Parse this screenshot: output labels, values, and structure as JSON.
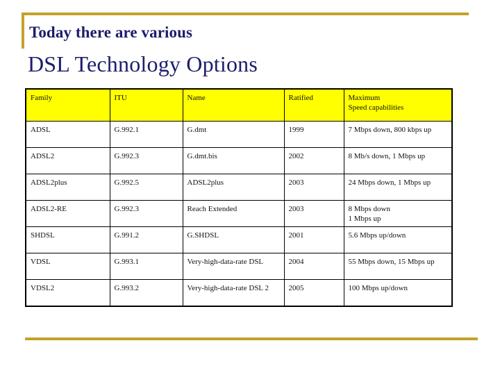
{
  "slide": {
    "subtitle": "Today there are various",
    "title": "DSL Technology Options",
    "accent_color": "#c2a22a",
    "title_color": "#1d1d6b",
    "header_fill": "#ffff00"
  },
  "table": {
    "headers": [
      "Family",
      "ITU",
      "Name",
      "Ratified",
      "Maximum\nSpeed capabilities"
    ],
    "header_max_line1": "Maximum",
    "header_max_line2": "Speed capabilities",
    "rows": [
      {
        "family": "ADSL",
        "itu": "G.992.1",
        "name": "G.dmt",
        "ratified": "1999",
        "max_speed": "7 Mbps down, 800 kbps up"
      },
      {
        "family": "ADSL2",
        "itu": "G.992.3",
        "name": "G.dmt.bis",
        "ratified": "2002",
        "max_speed": "8 Mb/s down, 1 Mbps up"
      },
      {
        "family": "ADSL2plus",
        "itu": "G.992.5",
        "name": "ADSL2plus",
        "ratified": "2003",
        "max_speed": "24 Mbps down, 1 Mbps up"
      },
      {
        "family": "ADSL2-RE",
        "itu": "G.992.3",
        "name": "Reach Extended",
        "ratified": "2003",
        "max_speed_line1": "8 Mbps down",
        "max_speed_line2": "1 Mbps up",
        "max_speed": "8 Mbps down 1 Mbps up"
      },
      {
        "family": "SHDSL",
        "itu": "G.991.2",
        "name": "G.SHDSL",
        "ratified": "2001",
        "max_speed": "5.6 Mbps up/down"
      },
      {
        "family": "VDSL",
        "itu": "G.993.1",
        "name": "Very-high-data-rate DSL",
        "ratified": "2004",
        "max_speed": "55 Mbps down, 15 Mbps up"
      },
      {
        "family": "VDSL2",
        "itu": "G.993.2",
        "name": "Very-high-data-rate DSL 2",
        "ratified": "2005",
        "max_speed": "100 Mbps up/down"
      }
    ]
  }
}
